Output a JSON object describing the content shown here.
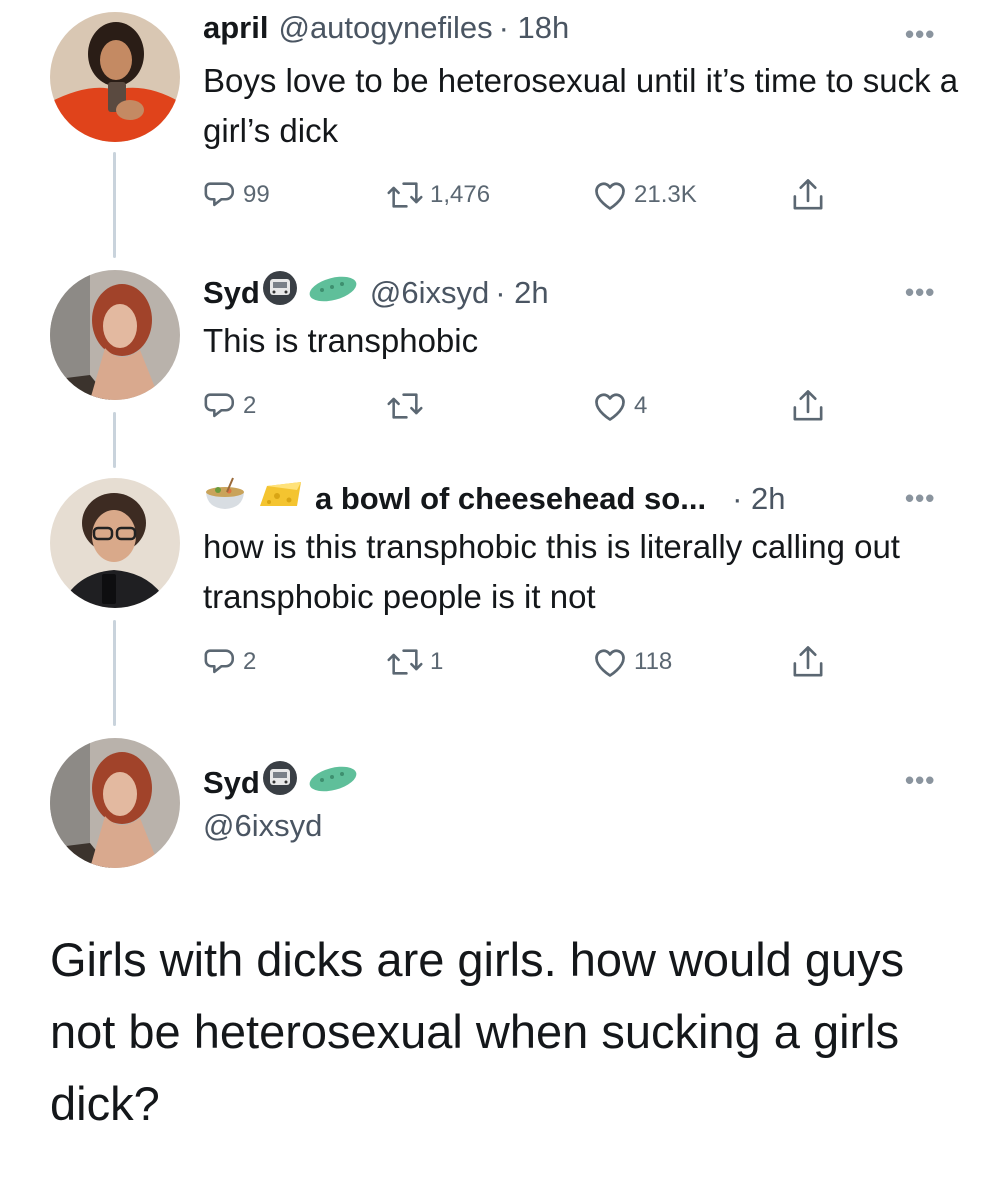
{
  "tweets": [
    {
      "name": "april",
      "handle": "@autogynefiles",
      "time": "· 18h",
      "text": "Boys love to be heterosexual until it’s time to suck a girl’s dick",
      "replies": "99",
      "retweets": "1,476",
      "likes": "21.3K",
      "avatar": "avatar-april"
    },
    {
      "name": "Syd",
      "handle": "@6ixsyd",
      "time": "· 2h",
      "text": "This is transphobic",
      "replies": "2",
      "retweets": "",
      "likes": "4",
      "avatar": "avatar-syd"
    },
    {
      "name": "a bowl of cheesehead so...",
      "handle": "",
      "time": "· 2h",
      "text": "how is this transphobic this is literally calling out transphobic people is it not",
      "replies": "2",
      "retweets": "1",
      "likes": "118",
      "avatar": "avatar-cheesehead"
    }
  ],
  "main_tweet": {
    "name": "Syd",
    "handle": "@6ixsyd",
    "text": "Girls with dicks are girls. how would guys not be heterosexual when sucking a girls dick?"
  },
  "icons": {
    "reply": "reply-icon",
    "retweet": "retweet-icon",
    "like": "heart-icon",
    "share": "share-icon",
    "more": "more-icon",
    "name_emoji_1": "train-emoji-icon",
    "name_emoji_2": "pill-emoji-icon",
    "cheese_emoji_1": "soup-bowl-emoji-icon",
    "cheese_emoji_2": "cheese-emoji-icon"
  },
  "colors": {
    "text": "#14171a",
    "secondary": "#5b6772",
    "thread_line": "#c9d3dc"
  }
}
